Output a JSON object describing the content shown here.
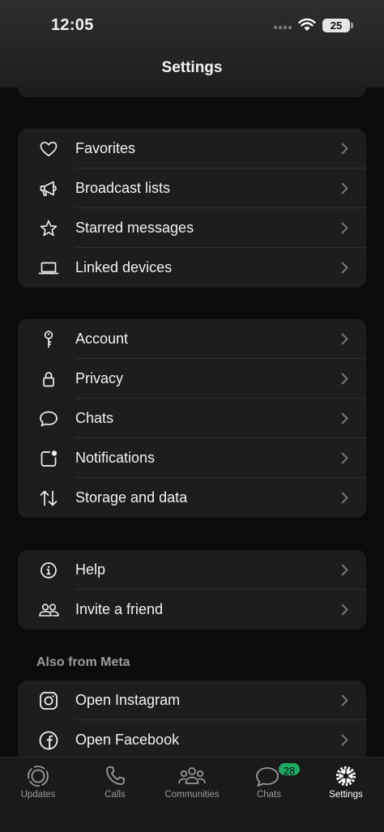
{
  "status_bar": {
    "time": "12:05",
    "battery": "25"
  },
  "header": {
    "title": "Settings"
  },
  "groups": [
    {
      "items": [
        {
          "label": "Favorites",
          "icon": "heart-icon"
        },
        {
          "label": "Broadcast lists",
          "icon": "megaphone-icon"
        },
        {
          "label": "Starred messages",
          "icon": "star-icon"
        },
        {
          "label": "Linked devices",
          "icon": "laptop-icon"
        }
      ]
    },
    {
      "items": [
        {
          "label": "Account",
          "icon": "key-icon"
        },
        {
          "label": "Privacy",
          "icon": "lock-icon"
        },
        {
          "label": "Chats",
          "icon": "chat-bubble-icon"
        },
        {
          "label": "Notifications",
          "icon": "notification-icon"
        },
        {
          "label": "Storage and data",
          "icon": "storage-arrows-icon"
        }
      ]
    },
    {
      "items": [
        {
          "label": "Help",
          "icon": "info-icon"
        },
        {
          "label": "Invite a friend",
          "icon": "people-icon"
        }
      ]
    }
  ],
  "meta_section": {
    "title": "Also from Meta",
    "items": [
      {
        "label": "Open Instagram",
        "icon": "instagram-icon"
      },
      {
        "label": "Open Facebook",
        "icon": "facebook-icon"
      }
    ]
  },
  "tab_bar": {
    "tabs": [
      {
        "label": "Updates",
        "icon": "updates-icon"
      },
      {
        "label": "Calls",
        "icon": "phone-icon"
      },
      {
        "label": "Communities",
        "icon": "communities-icon"
      },
      {
        "label": "Chats",
        "icon": "chats-icon",
        "badge": "28"
      },
      {
        "label": "Settings",
        "icon": "settings-gear-icon",
        "active": true
      }
    ]
  },
  "colors": {
    "background": "#0b0b0b",
    "card": "#1d1d1d",
    "badge": "#1daa61"
  }
}
